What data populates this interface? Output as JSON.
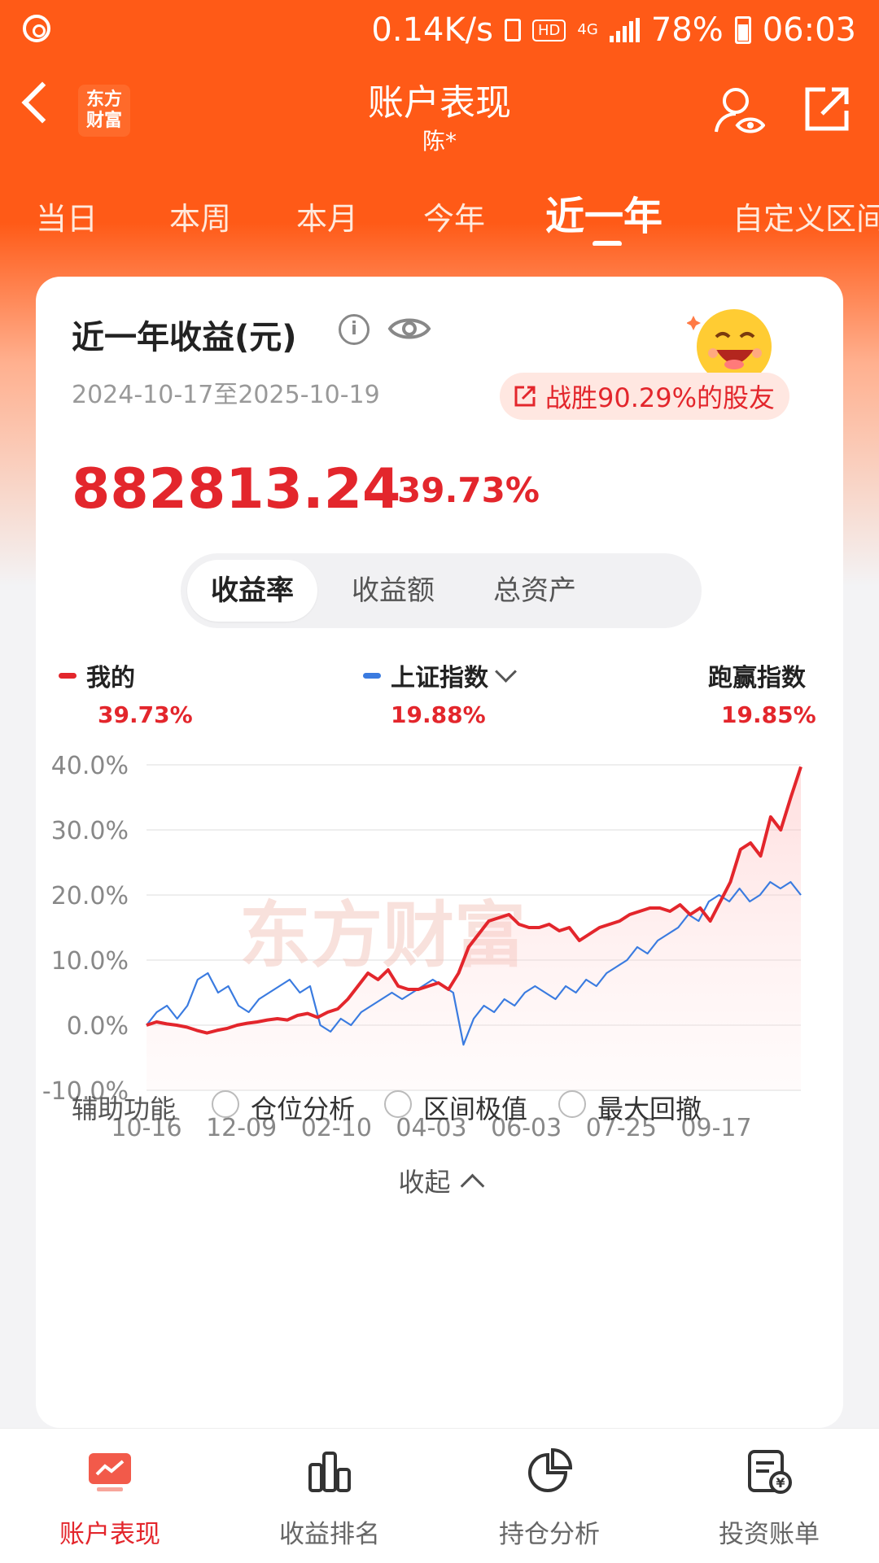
{
  "status_bar": {
    "speed": "0.14K/s",
    "hd": "HD",
    "net": "4G",
    "battery": "78%",
    "time": "06:03"
  },
  "header": {
    "logo": "东方\n财富",
    "title": "账户表现",
    "subtitle": "陈*"
  },
  "tabs": [
    {
      "label": "当日",
      "active": false
    },
    {
      "label": "本周",
      "active": false
    },
    {
      "label": "本月",
      "active": false
    },
    {
      "label": "今年",
      "active": false
    },
    {
      "label": "近一年",
      "active": true
    },
    {
      "label": "自定义区间",
      "active": false
    }
  ],
  "card": {
    "title": "近一年收益(元)",
    "date_range": "2024-10-17至2025-10-19",
    "beat_text": "战胜90.29%的股友",
    "profit_value": "882813.24",
    "profit_pct": "39.73%",
    "segments": [
      {
        "label": "收益率",
        "active": true
      },
      {
        "label": "收益额",
        "active": false
      },
      {
        "label": "总资产",
        "active": false
      }
    ],
    "legend": [
      {
        "name": "我的",
        "value": "39.73%",
        "color": "#e3262c"
      },
      {
        "name": "上证指数",
        "value": "19.88%",
        "color": "#3a7be0"
      },
      {
        "name": "跑赢指数",
        "value": "19.85%"
      }
    ],
    "watermark": "东方财富",
    "aux": {
      "label": "辅助功能",
      "options": [
        "仓位分析",
        "区间极值",
        "最大回撤"
      ]
    },
    "collapse_label": "收起"
  },
  "chart_data": {
    "type": "line",
    "y_ticks": [
      "40.0%",
      "30.0%",
      "20.0%",
      "10.0%",
      "0.0%",
      "-10.0%"
    ],
    "x_ticks": [
      "10-16",
      "12-09",
      "02-10",
      "04-03",
      "06-03",
      "07-25",
      "09-17"
    ],
    "ylim": [
      -10,
      40
    ],
    "series": [
      {
        "name": "我的",
        "color": "#e3262c",
        "values": [
          0,
          0.5,
          0.2,
          0,
          -0.3,
          -0.8,
          -1.2,
          -0.8,
          -0.5,
          0,
          0.3,
          0.5,
          0.8,
          1,
          0.8,
          1.5,
          1.8,
          1.2,
          2,
          2.5,
          4,
          6,
          8,
          7,
          8.5,
          6,
          5.5,
          5.5,
          6,
          6.5,
          5.5,
          8,
          12,
          14,
          16,
          16.5,
          17,
          15.5,
          15,
          15,
          15.5,
          14.5,
          15,
          13,
          14,
          15,
          15.5,
          16,
          17,
          17.5,
          18,
          18,
          17.5,
          18.5,
          17,
          18,
          16,
          19,
          22,
          27,
          28,
          26,
          32,
          30,
          35,
          39.7
        ]
      },
      {
        "name": "上证指数",
        "color": "#3a7be0",
        "values": [
          0,
          2,
          3,
          1,
          3,
          7,
          8,
          5,
          6,
          3,
          2,
          4,
          5,
          6,
          7,
          5,
          6,
          0,
          -1,
          1,
          0,
          2,
          3,
          4,
          5,
          4,
          5,
          6,
          7,
          6,
          5,
          -3,
          1,
          3,
          2,
          4,
          3,
          5,
          6,
          5,
          4,
          6,
          5,
          7,
          6,
          8,
          9,
          10,
          12,
          11,
          13,
          14,
          15,
          17,
          16,
          19,
          20,
          19,
          21,
          19,
          20,
          22,
          21,
          22,
          20
        ]
      }
    ]
  },
  "bottom_nav": [
    {
      "label": "账户表现",
      "icon": "chart-screen-icon",
      "active": true
    },
    {
      "label": "收益排名",
      "icon": "bar-chart-icon",
      "active": false
    },
    {
      "label": "持仓分析",
      "icon": "pie-chart-icon",
      "active": false
    },
    {
      "label": "投资账单",
      "icon": "bill-icon",
      "active": false
    }
  ]
}
